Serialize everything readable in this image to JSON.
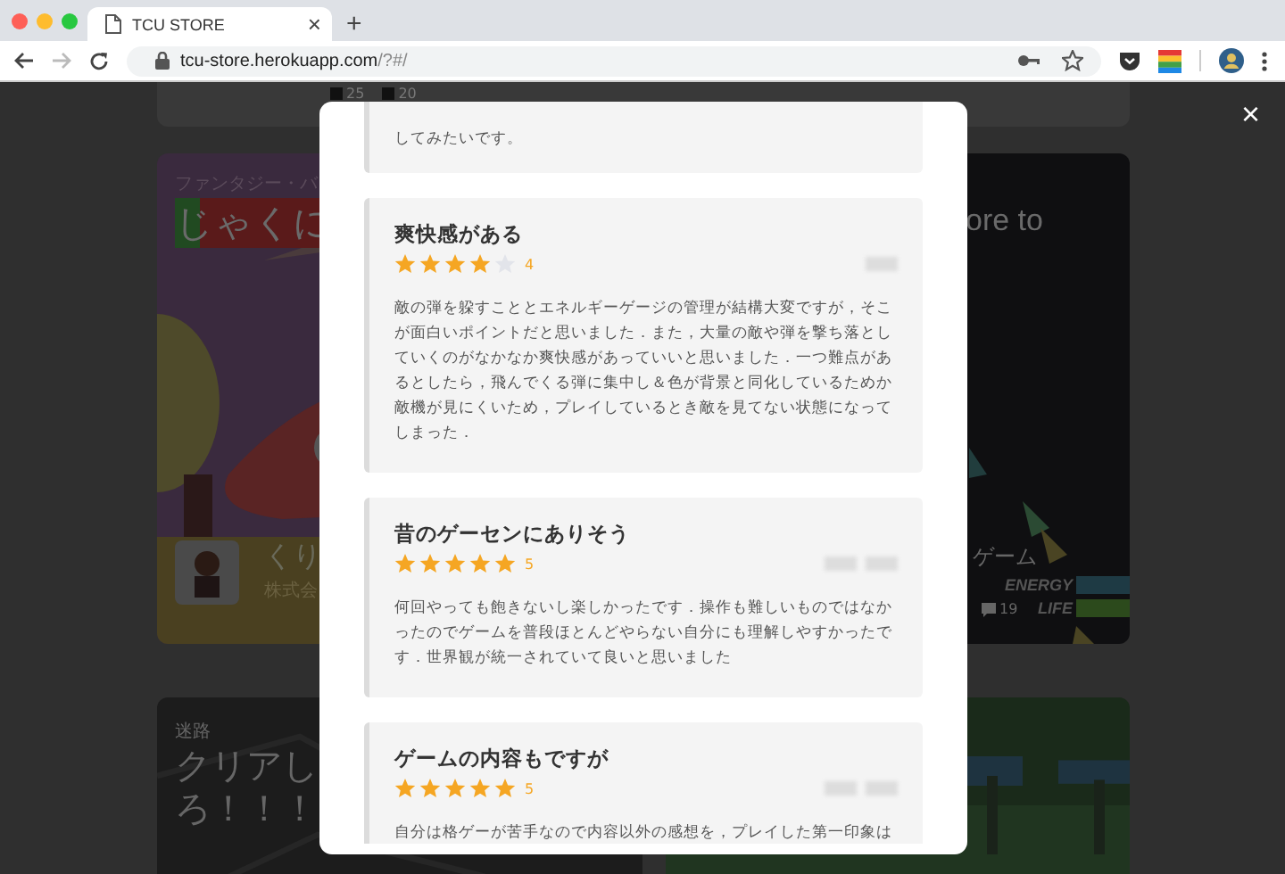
{
  "browser": {
    "tab_title": "TCU STORE",
    "new_tab": "+",
    "close_tab": "×",
    "url_host": "tcu-store.herokuapp.com",
    "url_path": "/?#/"
  },
  "background": {
    "top_card": {
      "counts": [
        "25",
        "20"
      ]
    },
    "cards": [
      {
        "kind": "fantasy",
        "genre": "ファンタジー・バ",
        "title": "じゃくに",
        "app_name": "くり",
        "company": "株式会"
      },
      {
        "kind": "space",
        "title": "ore to",
        "subtitle": "ゲーム",
        "energy": "ENERGY",
        "life": "LIFE",
        "comments": "19"
      },
      {
        "kind": "maze",
        "genre": "迷路",
        "title_lines": [
          "クリアし",
          "ろ！！！"
        ]
      },
      {
        "kind": "forest"
      }
    ]
  },
  "modal": {
    "close": "×",
    "reviews": [
      {
        "body": "してみたいです。"
      },
      {
        "title": "爽快感がある",
        "stars": 4,
        "rating": "4",
        "body": "敵の弾を躱すこととエネルギーゲージの管理が結構大変ですが，そこが面白いポイントだと思いました．また，大量の敵や弾を撃ち落としていくのがなかなか爽快感があっていいと思いました．一つ難点があるとしたら，飛んでくる弾に集中し＆色が背景と同化しているためか敵機が見にくいため，プレイしているとき敵を見てない状態になってしまった．"
      },
      {
        "title": "昔のゲーセンにありそう",
        "stars": 5,
        "rating": "5",
        "body": "何回やっても飽きないし楽しかったです．操作も難しいものではなかったのでゲームを普段ほとんどやらない自分にも理解しやすかったです．世界観が統一されていて良いと思いました"
      },
      {
        "title": "ゲームの内容もですが",
        "stars": 5,
        "rating": "5",
        "body": "自分は格ゲーが苦手なので内容以外の感想を，プレイした第一印象は"
      }
    ]
  }
}
